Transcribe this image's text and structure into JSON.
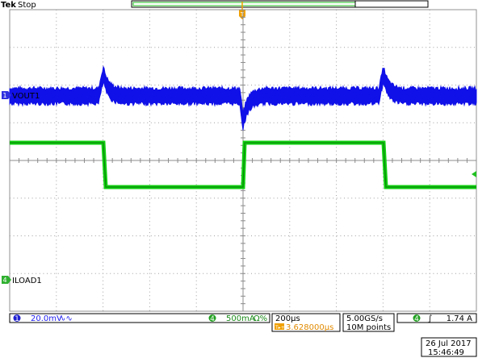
{
  "header": {
    "brand": "Tek",
    "status": "Stop"
  },
  "channels": {
    "ch1": {
      "number": "1",
      "label": "VOUT1",
      "scale": "20.0mV",
      "coupling_icon": "∿∿",
      "color": "#1010e8"
    },
    "ch4": {
      "number": "4",
      "label": "ILOAD1",
      "scale": "500mA",
      "coupling_icon": "Ω%",
      "color": "#10d010"
    }
  },
  "trigger_marker": {
    "text": "T",
    "color": "#f0a000"
  },
  "timebase": {
    "scale": "200µs",
    "delay_icon": "T▸+▾",
    "delay": "3.628000µs"
  },
  "acquisition": {
    "sample_rate": "5.00GS/s",
    "record_length": "10M points"
  },
  "trigger": {
    "channel": "4",
    "slope_icon": "∫",
    "level": "1.74 A"
  },
  "datetime": {
    "date": "26 Jul  2017",
    "time": "15:46:49"
  },
  "colors": {
    "grid": "#a0a0a0",
    "ch1": "#1010e8",
    "ch4": "#10d010",
    "trigger": "#f0a000"
  }
}
